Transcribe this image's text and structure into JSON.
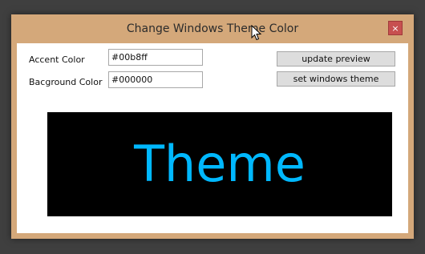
{
  "window": {
    "title": "Change Windows Theme Color",
    "close_glyph": "×",
    "frame_color": "#d4a87a"
  },
  "form": {
    "accent_label": "Accent Color",
    "accent_value": "#00b8ff",
    "background_label": "Bacground Color",
    "background_value": "#000000"
  },
  "buttons": {
    "update_preview": "update preview",
    "set_theme": "set windows theme"
  },
  "preview": {
    "text": "Theme",
    "text_color": "#00b8ff",
    "bg_color": "#000000"
  },
  "icons": {
    "close": "close-icon",
    "cursor": "mouse-pointer-icon"
  }
}
